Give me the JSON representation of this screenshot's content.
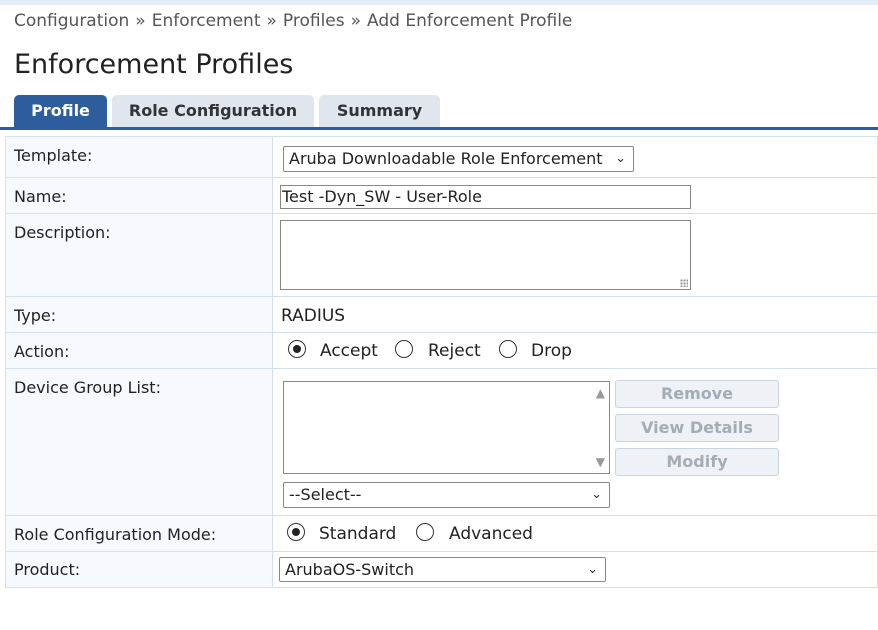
{
  "breadcrumb": {
    "items": [
      "Configuration",
      "Enforcement",
      "Profiles",
      "Add Enforcement Profile"
    ],
    "separator": "»"
  },
  "page": {
    "title": "Enforcement Profiles"
  },
  "tabs": [
    {
      "label": "Profile",
      "active": true
    },
    {
      "label": "Role Configuration",
      "active": false
    },
    {
      "label": "Summary",
      "active": false
    }
  ],
  "form": {
    "template": {
      "label": "Template:",
      "value": "Aruba Downloadable Role Enforcement"
    },
    "name": {
      "label": "Name:",
      "value": "Test -Dyn_SW - User-Role"
    },
    "description": {
      "label": "Description:",
      "value": ""
    },
    "type": {
      "label": "Type:",
      "value": "RADIUS"
    },
    "action": {
      "label": "Action:",
      "options": [
        "Accept",
        "Reject",
        "Drop"
      ],
      "selected": "Accept"
    },
    "device_group_list": {
      "label": "Device Group List:",
      "select_value": "--Select--",
      "buttons": {
        "remove": "Remove",
        "view_details": "View Details",
        "modify": "Modify"
      }
    },
    "role_configuration_mode": {
      "label": "Role Configuration Mode:",
      "options": [
        "Standard",
        "Advanced"
      ],
      "selected": "Standard"
    },
    "product": {
      "label": "Product:",
      "value": "ArubaOS-Switch"
    }
  },
  "colors": {
    "accent": "#2d5d9c",
    "label_bg": "#f6fafe",
    "border": "#d3e1ea"
  },
  "icons": {
    "dropdown": "chevron-down-icon",
    "resize": "resize-grip-icon"
  }
}
